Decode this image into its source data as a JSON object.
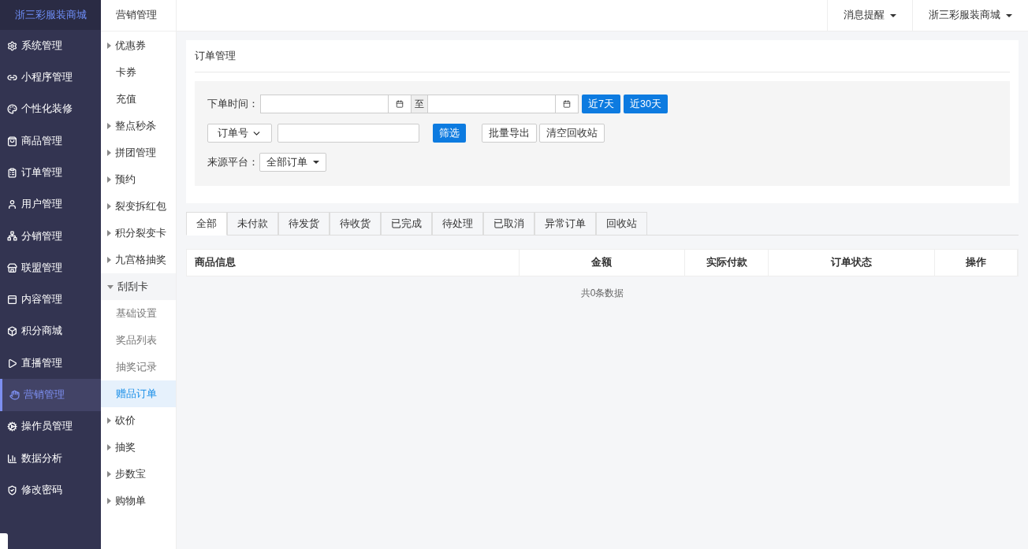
{
  "brand": "浙三彩服装商城",
  "sidebar": {
    "items": [
      {
        "label": "系统管理",
        "selected": false
      },
      {
        "label": "小程序管理",
        "selected": false
      },
      {
        "label": "个性化装修",
        "selected": false
      },
      {
        "label": "商品管理",
        "selected": false
      },
      {
        "label": "订单管理",
        "selected": false
      },
      {
        "label": "用户管理",
        "selected": false
      },
      {
        "label": "分销管理",
        "selected": false
      },
      {
        "label": "联盟管理",
        "selected": false
      },
      {
        "label": "内容管理",
        "selected": false
      },
      {
        "label": "积分商城",
        "selected": false
      },
      {
        "label": "直播管理",
        "selected": false
      },
      {
        "label": "营销管理",
        "selected": true
      },
      {
        "label": "操作员管理",
        "selected": false
      },
      {
        "label": "数据分析",
        "selected": false
      },
      {
        "label": "修改密码",
        "selected": false
      }
    ]
  },
  "subnav": {
    "title": "营销管理",
    "items": [
      {
        "kind": "group",
        "label": "优惠券",
        "expanded": false
      },
      {
        "kind": "link",
        "label": "卡券",
        "selected": false
      },
      {
        "kind": "link",
        "label": "充值",
        "selected": false
      },
      {
        "kind": "group",
        "label": "整点秒杀",
        "expanded": false
      },
      {
        "kind": "group",
        "label": "拼团管理",
        "expanded": false
      },
      {
        "kind": "group",
        "label": "预约",
        "expanded": false
      },
      {
        "kind": "group",
        "label": "裂变拆红包",
        "expanded": false
      },
      {
        "kind": "group",
        "label": "积分裂变卡",
        "expanded": false
      },
      {
        "kind": "group",
        "label": "九宫格抽奖",
        "expanded": false
      },
      {
        "kind": "group",
        "label": "刮刮卡",
        "expanded": true,
        "children": [
          {
            "label": "基础设置",
            "selected": false
          },
          {
            "label": "奖品列表",
            "selected": false
          },
          {
            "label": "抽奖记录",
            "selected": false
          },
          {
            "label": "赠品订单",
            "selected": true
          }
        ]
      },
      {
        "kind": "group",
        "label": "砍价",
        "expanded": false
      },
      {
        "kind": "group",
        "label": "抽奖",
        "expanded": false
      },
      {
        "kind": "group",
        "label": "步数宝",
        "expanded": false
      },
      {
        "kind": "group",
        "label": "购物单",
        "expanded": false
      }
    ]
  },
  "header": {
    "menus": [
      "消息提醒",
      "浙三彩服装商城"
    ]
  },
  "panel": {
    "title": "订单管理",
    "date_label": "下单时间：",
    "date_separator": "至",
    "quick_buttons": [
      "近7天",
      "近30天"
    ],
    "search_type": "订单号",
    "filter_button": "筛选",
    "actions": [
      "批量导出",
      "清空回收站"
    ],
    "platform_label": "来源平台：",
    "platform_value": "全部订单"
  },
  "tabs": [
    {
      "label": "全部",
      "selected": true
    },
    {
      "label": "未付款",
      "selected": false
    },
    {
      "label": "待发货",
      "selected": false
    },
    {
      "label": "待收货",
      "selected": false
    },
    {
      "label": "已完成",
      "selected": false
    },
    {
      "label": "待处理",
      "selected": false
    },
    {
      "label": "已取消",
      "selected": false
    },
    {
      "label": "异常订单",
      "selected": false
    },
    {
      "label": "回收站",
      "selected": false
    }
  ],
  "table": {
    "columns": [
      "商品信息",
      "金额",
      "实际付款",
      "订单状态",
      "操作"
    ],
    "empty_text": "共0条数据"
  }
}
